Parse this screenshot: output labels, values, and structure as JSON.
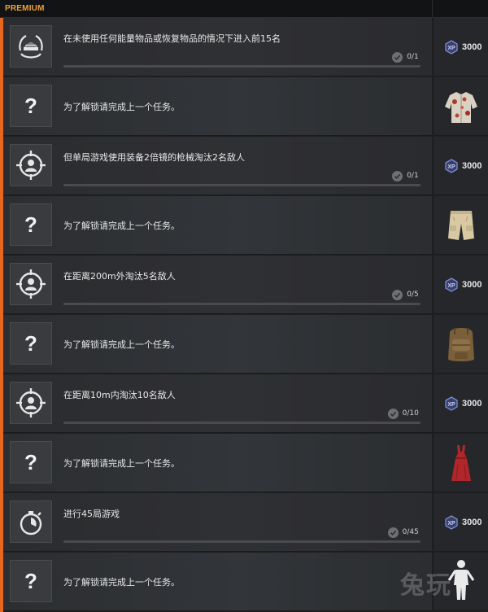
{
  "header": {
    "label": "PREMIUM"
  },
  "colors": {
    "accent": "#e8671f",
    "header_text": "#f0a13c",
    "xp_badge": "#7b8cd9"
  },
  "missions": [
    {
      "id": "m1",
      "icon": "wreath-helmet-icon",
      "text": "在未使用任何能量物品或恢复物品的情况下进入前15名",
      "progress": "0/1",
      "progress_fraction": 0,
      "reward_type": "xp",
      "reward_amount": "3000"
    },
    {
      "id": "m2",
      "icon": "question-mark-icon",
      "text": "为了解锁请完成上一个任务。",
      "locked": true,
      "reward_type": "item",
      "reward_item": "floral-shirt-icon"
    },
    {
      "id": "m3",
      "icon": "crosshair-person-icon",
      "text": "但单局游戏使用装备2倍镜的枪械淘汰2名敌人",
      "progress": "0/1",
      "progress_fraction": 0,
      "reward_type": "xp",
      "reward_amount": "3000"
    },
    {
      "id": "m4",
      "icon": "question-mark-icon",
      "text": "为了解锁请完成上一个任务。",
      "locked": true,
      "reward_type": "item",
      "reward_item": "cargo-shorts-icon"
    },
    {
      "id": "m5",
      "icon": "crosshair-person-icon",
      "text": "在距离200m外淘汰5名敌人",
      "progress": "0/5",
      "progress_fraction": 0,
      "reward_type": "xp",
      "reward_amount": "3000"
    },
    {
      "id": "m6",
      "icon": "question-mark-icon",
      "text": "为了解锁请完成上一个任务。",
      "locked": true,
      "reward_type": "item",
      "reward_item": "backpack-icon"
    },
    {
      "id": "m7",
      "icon": "crosshair-person-icon",
      "text": "在距离10m内淘汰10名敌人",
      "progress": "0/10",
      "progress_fraction": 0,
      "reward_type": "xp",
      "reward_amount": "3000"
    },
    {
      "id": "m8",
      "icon": "question-mark-icon",
      "text": "为了解锁请完成上一个任务。",
      "locked": true,
      "reward_type": "item",
      "reward_item": "red-dress-icon"
    },
    {
      "id": "m9",
      "icon": "stopwatch-icon",
      "text": "进行45局游戏",
      "progress": "0/45",
      "progress_fraction": 0,
      "reward_type": "xp",
      "reward_amount": "3000"
    },
    {
      "id": "m10",
      "icon": "question-mark-icon",
      "text": "为了解锁请完成上一个任务。",
      "locked": true,
      "reward_type": "item",
      "reward_item": "character-silhouette-icon"
    }
  ],
  "question_glyph": "?",
  "watermark": "兔玩"
}
